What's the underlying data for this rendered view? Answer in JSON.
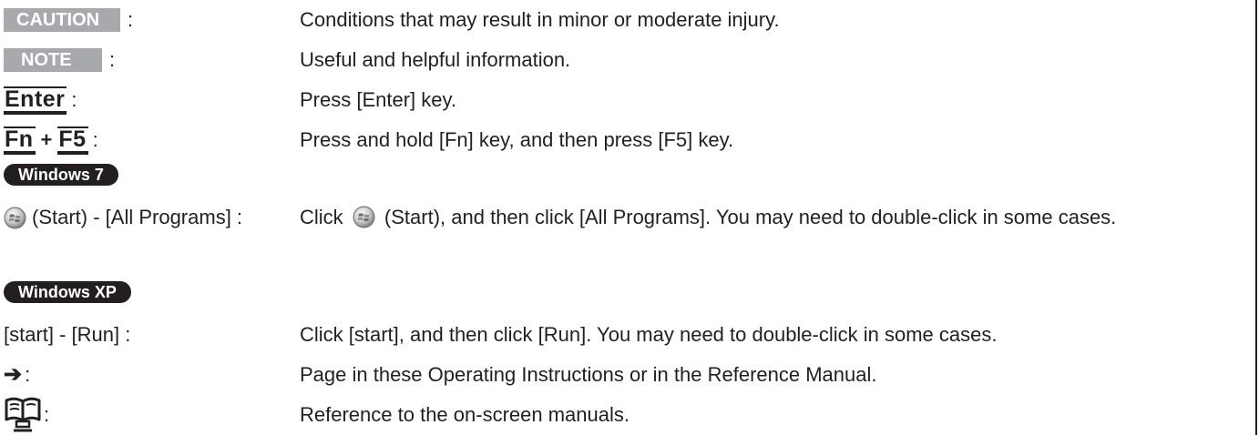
{
  "rows": {
    "caution": {
      "tag": "CAUTION",
      "sep": ":",
      "desc": "Conditions that may result in minor or moderate injury."
    },
    "note": {
      "tag": "NOTE",
      "sep": ":",
      "desc": "Useful and helpful information."
    },
    "enter": {
      "key": "Enter",
      "sep": ":",
      "desc": "Press [Enter] key."
    },
    "fn_f5": {
      "key1": "Fn",
      "plus": "+",
      "key2": "F5",
      "sep": ":",
      "desc": "Press and hold [Fn] key, and then press [F5] key."
    },
    "win7_start": {
      "term": "(Start) - [All Programs] :",
      "desc_before": "Click",
      "desc_after": "(Start), and then click [All Programs]. You may need to double-click in some cases."
    },
    "xp_run": {
      "term": "[start] - [Run] :",
      "desc": "Click [start], and then click [Run]. You may need to double-click in some cases."
    },
    "arrow": {
      "sep": ":",
      "desc": "Page in these Operating Instructions or in the Reference Manual."
    },
    "manual": {
      "sep": ":",
      "desc": "Reference to the on-screen manuals."
    }
  },
  "os_tags": {
    "win7": "Windows 7",
    "xp": "Windows XP"
  },
  "icons": {
    "start": "windows-start-orb-icon",
    "arrow": "right-arrow-icon",
    "manual": "open-book-monitor-icon"
  },
  "colors": {
    "tag_gray": "#a7a9ac",
    "ink": "#231f20"
  }
}
